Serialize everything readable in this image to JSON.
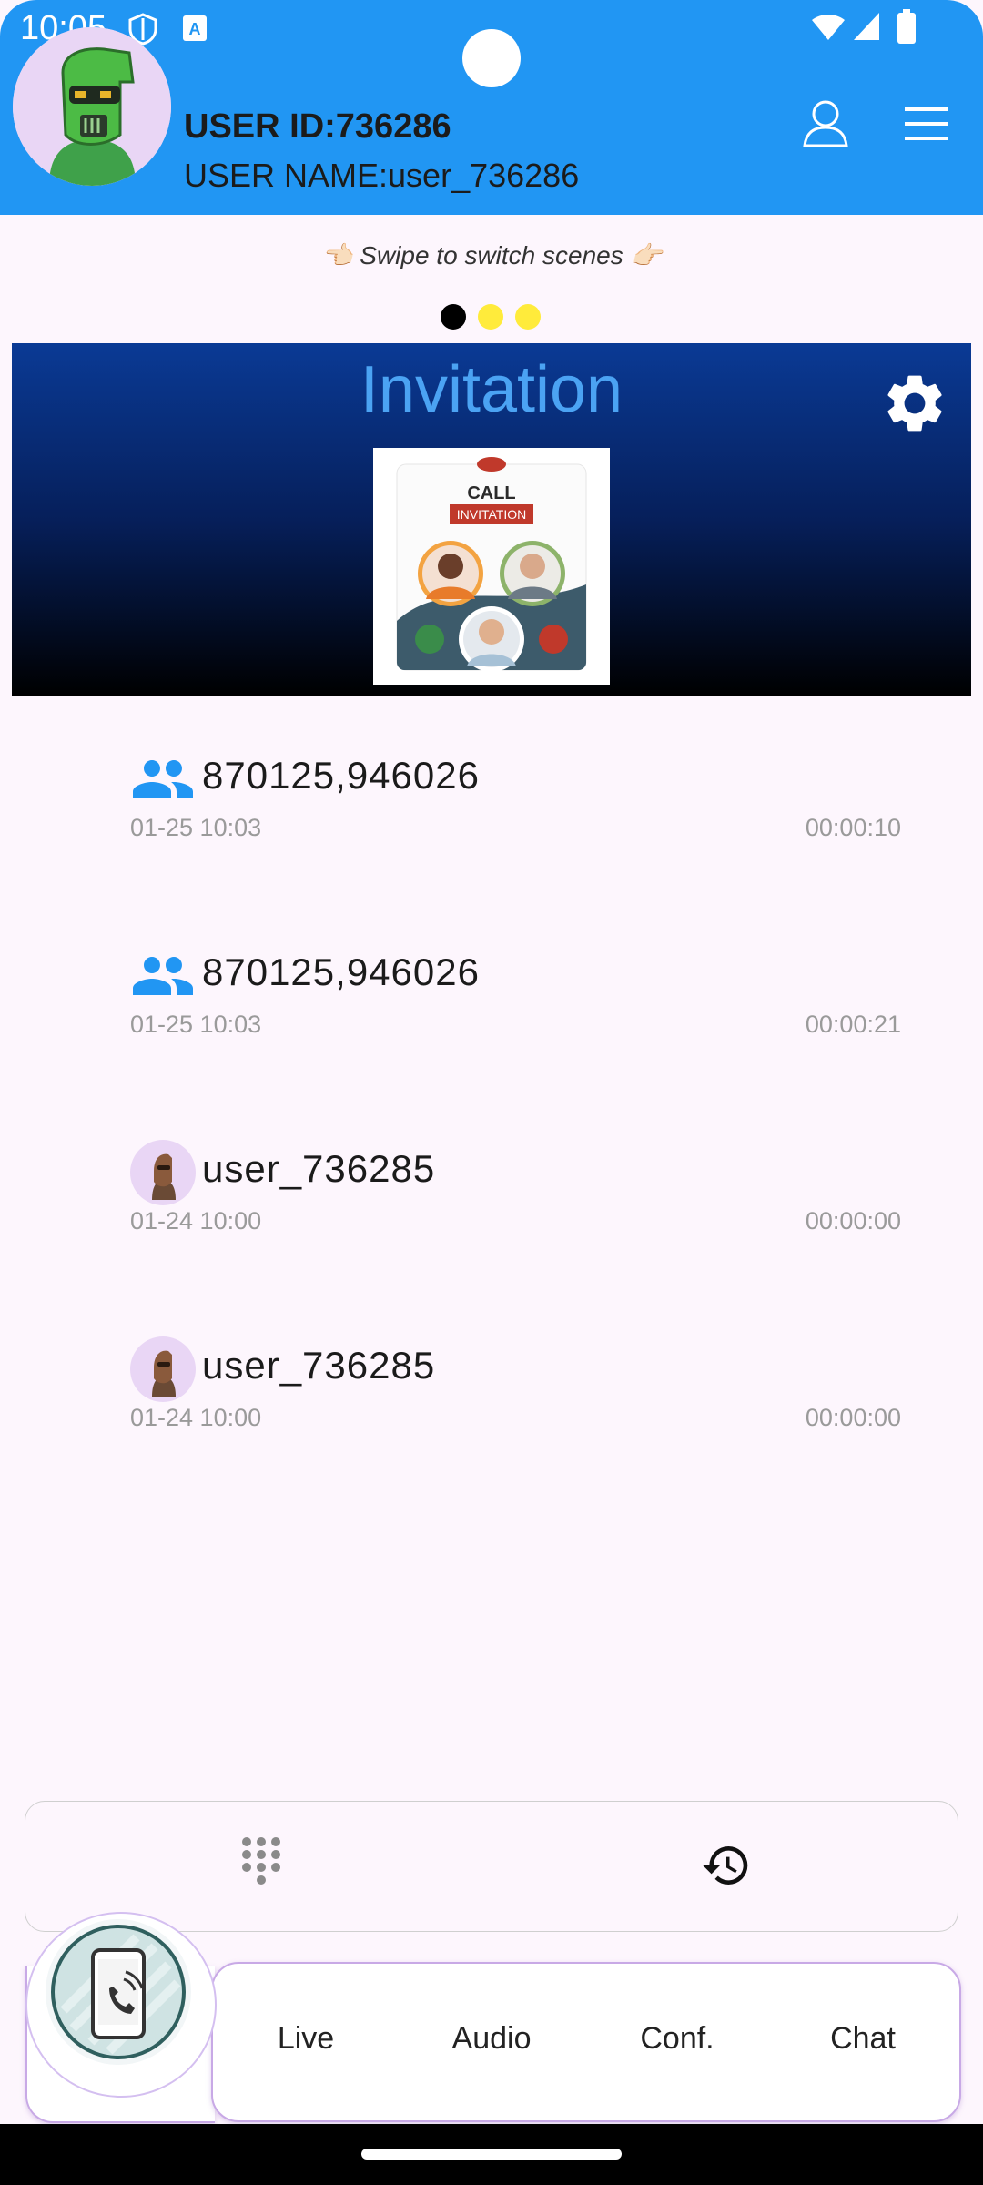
{
  "status": {
    "time": "10:05"
  },
  "header": {
    "user_id": "USER ID:736286",
    "user_name": "USER NAME:user_736286"
  },
  "hint": {
    "text": "👈🏻 Swipe to switch scenes 👉🏻"
  },
  "pager": {
    "dots": [
      "#000000",
      "#ffeb3b",
      "#ffeb3b"
    ]
  },
  "banner": {
    "title": "Invitation",
    "image": {
      "line1": "CALL",
      "line2": "INVITATION"
    }
  },
  "calls": [
    {
      "type": "group",
      "title": "870125,946026",
      "time": "01-25 10:03",
      "duration": "00:00:10"
    },
    {
      "type": "group",
      "title": "870125,946026",
      "time": "01-25 10:03",
      "duration": "00:00:21"
    },
    {
      "type": "user",
      "title": "user_736285",
      "time": "01-24 10:00",
      "duration": "00:00:00"
    },
    {
      "type": "user",
      "title": "user_736285",
      "time": "01-24 10:00",
      "duration": "00:00:00"
    }
  ],
  "nav": {
    "items": [
      {
        "label": "Live"
      },
      {
        "label": "Audio"
      },
      {
        "label": "Conf."
      },
      {
        "label": "Chat"
      }
    ]
  },
  "colors": {
    "header": "#2196f3",
    "accent_blue": "#4ba3f3",
    "background": "#fdf6fd"
  }
}
